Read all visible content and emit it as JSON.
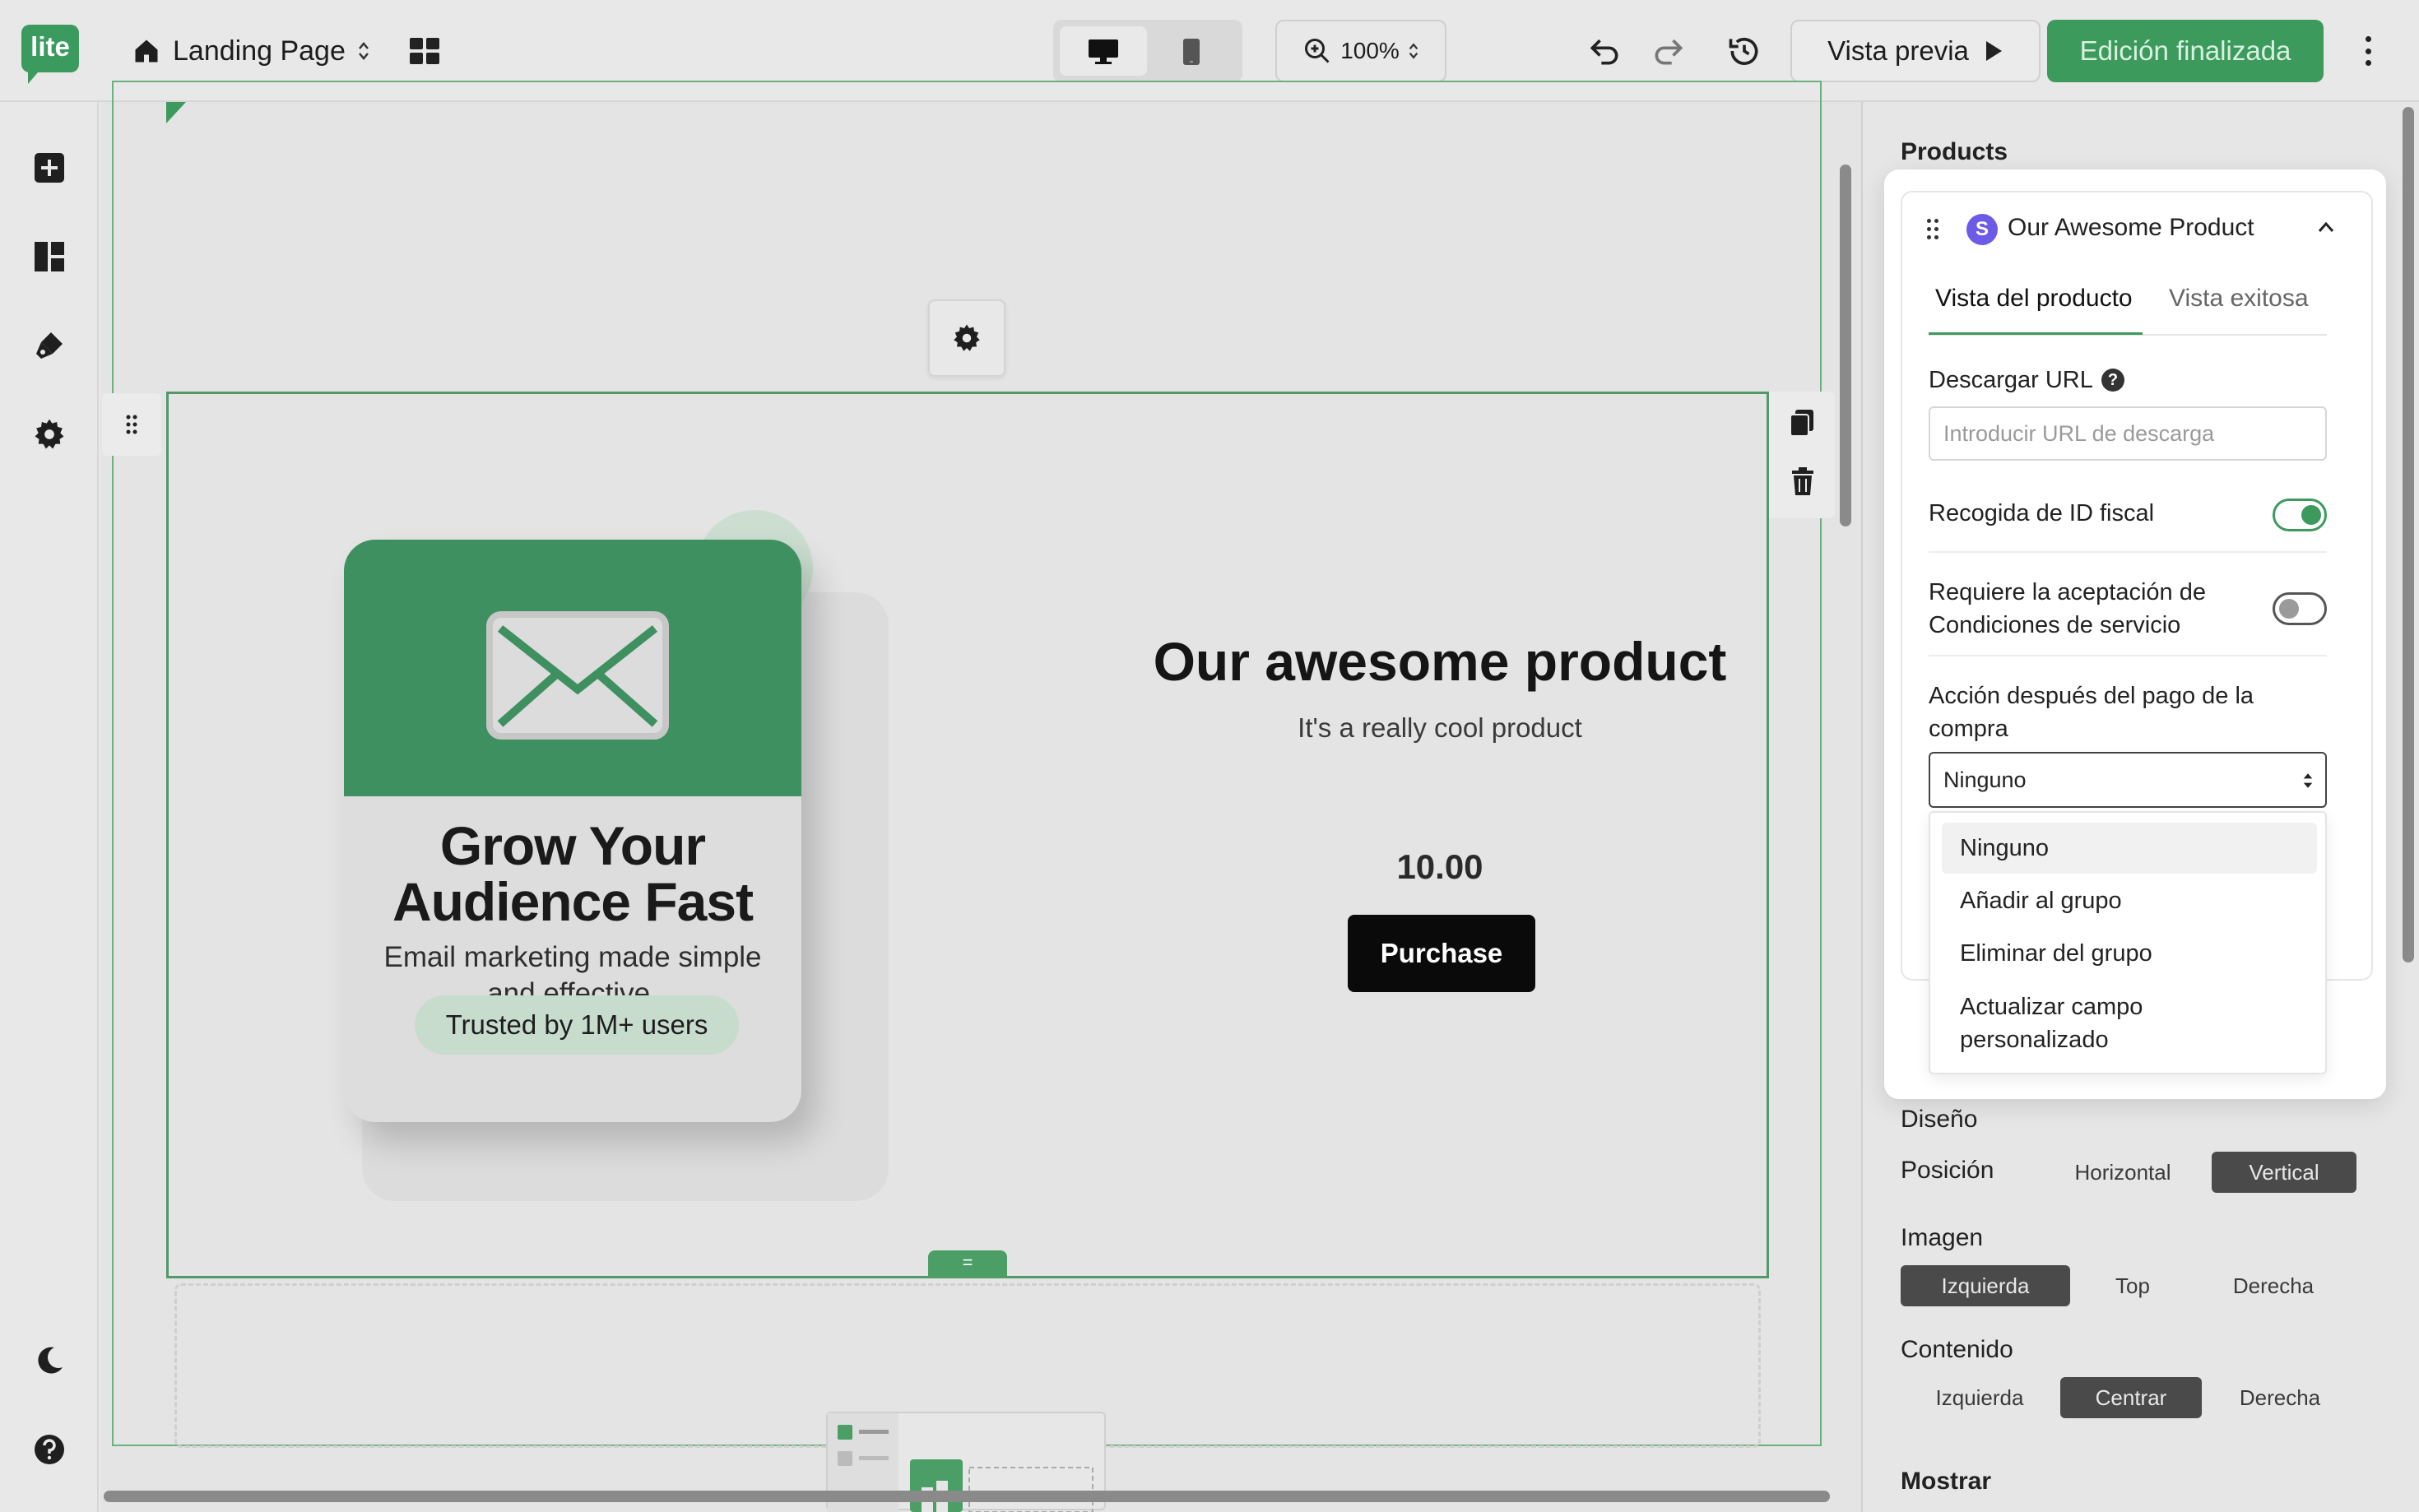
{
  "topbar": {
    "logo": "lite",
    "page_name": "Landing Page",
    "zoom": "100%",
    "preview_label": "Vista previa",
    "done_label": "Edición finalizada"
  },
  "canvas": {
    "card": {
      "title": "Grow Your Audience Fast",
      "subtitle": "Email marketing made simple and effective.",
      "pill": "Trusted by 1M+ users"
    },
    "product": {
      "heading": "Our awesome product",
      "tagline": "It's a really cool product",
      "price": "10.00",
      "button": "Purchase"
    },
    "handle_label": "="
  },
  "panel": {
    "section_title": "Products",
    "product": {
      "badge": "S",
      "name": "Our Awesome Product",
      "tabs": [
        "Vista del producto",
        "Vista exitosa"
      ],
      "download_label": "Descargar URL",
      "download_placeholder": "Introducir URL de descarga",
      "help": "?",
      "tax_id_label": "Recogida de ID fiscal",
      "tax_id_on": true,
      "terms_label": "Requiere la aceptación de Condiciones de servicio",
      "terms_on": false,
      "after_payment_label": "Acción después del pago de la compra",
      "after_payment_value": "Ninguno",
      "after_payment_options": [
        "Ninguno",
        "Añadir al grupo",
        "Eliminar del grupo",
        "Actualizar campo personalizado"
      ]
    },
    "design": {
      "title": "Diseño",
      "position_label": "Posición",
      "position_options": [
        "Horizontal",
        "Vertical"
      ],
      "position_selected": "Vertical",
      "image_label": "Imagen",
      "image_options": [
        "Izquierda",
        "Top",
        "Derecha"
      ],
      "image_selected": "Izquierda",
      "content_label": "Contenido",
      "content_options": [
        "Izquierda",
        "Centrar",
        "Derecha"
      ],
      "content_selected": "Centrar",
      "show_label": "Mostrar"
    }
  },
  "colors": {
    "brand_green": "#3c9a5d",
    "stripe_purple": "#6b5be6"
  }
}
